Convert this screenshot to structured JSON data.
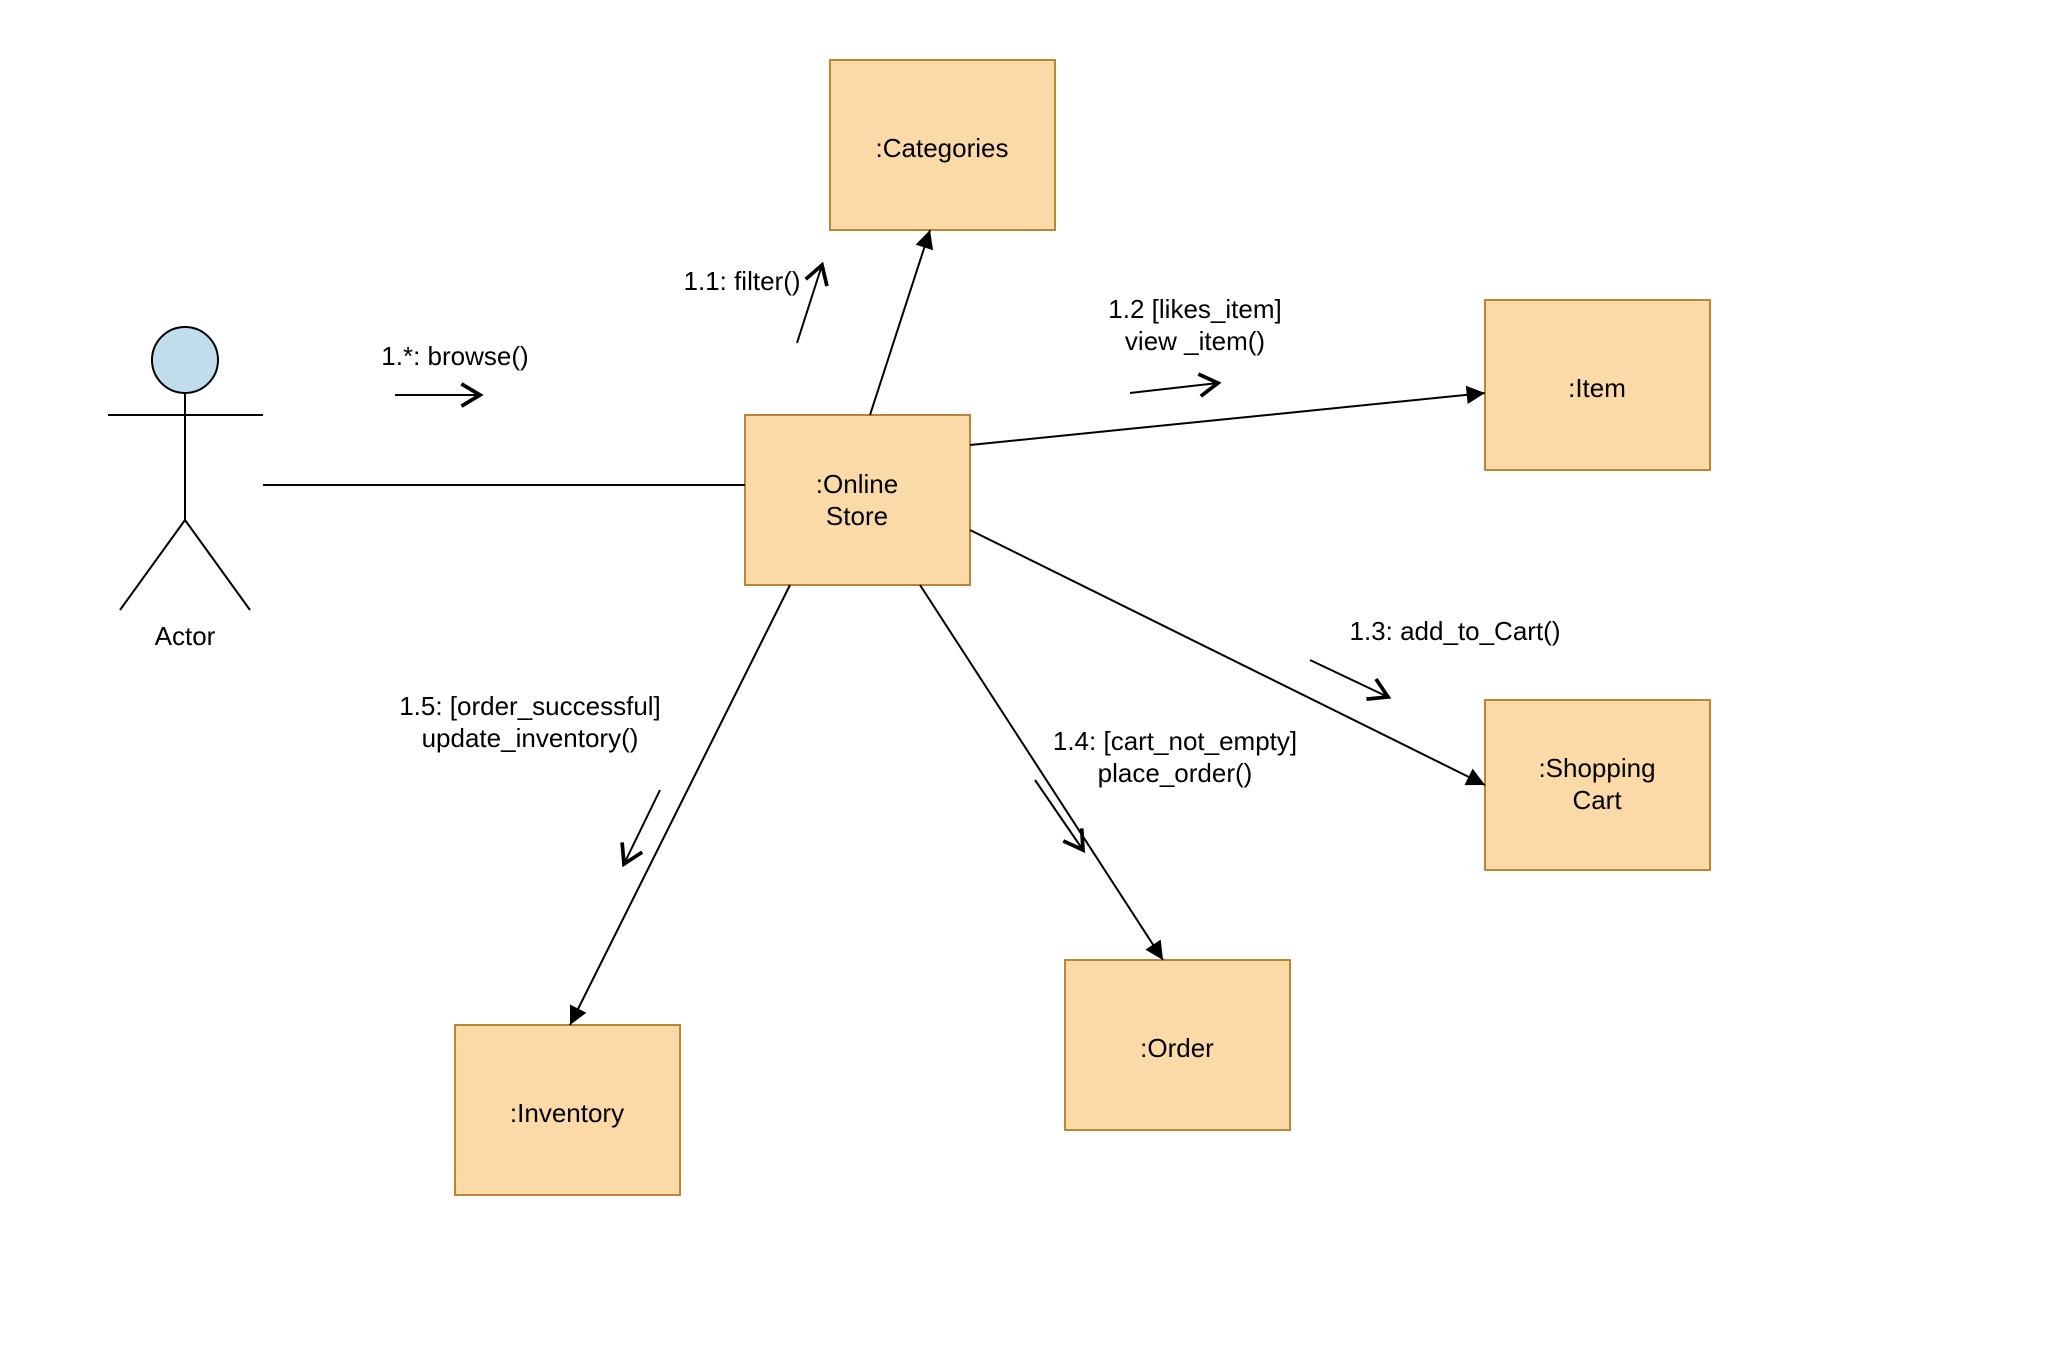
{
  "actor": {
    "label": "Actor"
  },
  "nodes": {
    "onlineStore": {
      "line1": ":Online",
      "line2": "Store"
    },
    "categories": {
      "line1": ":Categories"
    },
    "item": {
      "line1": ":Item"
    },
    "shoppingCart": {
      "line1": ":Shopping",
      "line2": "Cart"
    },
    "order": {
      "line1": ":Order"
    },
    "inventory": {
      "line1": ":Inventory"
    }
  },
  "edges": {
    "browse": {
      "label": "1.*: browse()"
    },
    "filter": {
      "label": "1.1: filter()"
    },
    "viewItem": {
      "line1": "1.2 [likes_item]",
      "line2": "view _item()"
    },
    "addCart": {
      "label": "1.3: add_to_Cart()"
    },
    "placeOrder": {
      "line1": "1.4: [cart_not_empty]",
      "line2": "place_order()"
    },
    "updateInv": {
      "line1": "1.5: [order_successful]",
      "line2": "update_inventory()"
    }
  }
}
